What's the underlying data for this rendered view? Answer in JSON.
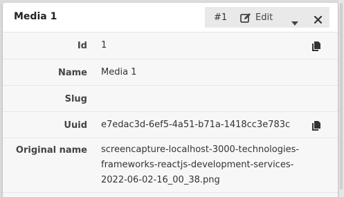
{
  "panel": {
    "title": "Media 1",
    "toolbar": {
      "id_label": "#1",
      "edit_label": "Edit"
    }
  },
  "fields": [
    {
      "label": "Id",
      "value": "1",
      "copyable": true
    },
    {
      "label": "Name",
      "value": "Media 1",
      "copyable": false
    },
    {
      "label": "Slug",
      "value": "",
      "copyable": false
    },
    {
      "label": "Uuid",
      "value": "e7edac3d-6ef5-4a51-b71a-1418cc3e783c",
      "copyable": true
    },
    {
      "label": "Original name",
      "value_lines": [
        "screencapture-localhost-3000-technologies-",
        "frameworks-reactjs-development-services-",
        "2022-06-02-16_00_38.png"
      ],
      "copyable": false
    }
  ],
  "icons": {
    "edit": "pencil-square-icon",
    "caret": "caret-down-icon",
    "close": "close-icon",
    "copy": "copy-icon"
  }
}
